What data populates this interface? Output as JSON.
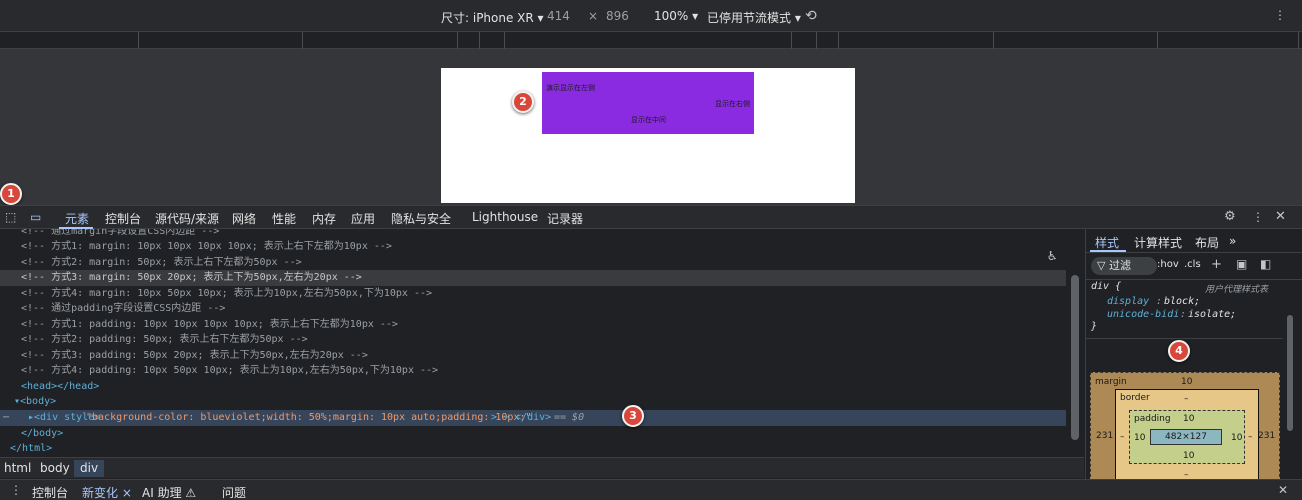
{
  "device_toolbar": {
    "dimensions_label": "尺寸: iPhone XR ▾",
    "width": "414",
    "times": "×",
    "height": "896",
    "zoom": "100% ▾",
    "throttle": "已停用节流模式 ▾"
  },
  "preview": {
    "left_text": "演示显示在左侧",
    "right_text": "显示在右侧",
    "center_text": "显示在中间",
    "box_color": "#8a2be2"
  },
  "badges": [
    "1",
    "2",
    "3",
    "4"
  ],
  "tabs": [
    "元素",
    "控制台",
    "源代码/来源",
    "网络",
    "性能",
    "内存",
    "应用",
    "隐私与安全",
    "Lighthouse",
    "记录器"
  ],
  "elements": {
    "lines": [
      "<!-- 通过margin字段设置CSS内边距 -->",
      "<!-- 方式1: margin: 10px 10px 10px 10px; 表示上右下左都为10px -->",
      "<!-- 方式2: margin: 50px; 表示上右下左都为50px -->",
      "<!-- 方式3: margin: 50px 20px; 表示上下为50px,左右为20px -->",
      "<!-- 方式4: margin: 10px 50px 10px; 表示上为10px,左右为50px,下为10px -->",
      "<!-- 通过padding字段设置CSS内边距 -->",
      "<!-- 方式1: padding: 10px 10px 10px 10px; 表示上右下左都为10px -->",
      "<!-- 方式2: padding: 50px; 表示上右下左都为50px -->",
      "<!-- 方式3: padding: 50px 20px; 表示上下为50px,左右为20px -->",
      "<!-- 方式4: padding: 10px 50px 10px; 表示上为10px,左右为50px,下为10px -->"
    ],
    "head_line": "<head></head>",
    "body_open": "▾<body>",
    "div_open": "▸<div style=",
    "div_style": "\"background-color: blueviolet;width: 50%;margin: 10px auto;padding: 10px;\"",
    "div_close": "> ⋯ </div>",
    "div_eq": "== $0",
    "body_close": "</body>",
    "html_close": "</html>"
  },
  "breadcrumbs": [
    "html",
    "body",
    "div"
  ],
  "styles": {
    "tabs": [
      "样式",
      "计算样式",
      "布局",
      "»"
    ],
    "filter": "▽ 过滤",
    "hov": ":hov",
    "cls": ".cls",
    "selector": "div {",
    "source": "用户代理样式表",
    "prop1_name": "display",
    "prop1_value": "block;",
    "prop2_name": "unicode-bidi",
    "prop2_value": "isolate;",
    "close": "}",
    "box": {
      "margin_label": "margin",
      "margin_top": "10",
      "margin_left": "231",
      "margin_right": "231",
      "border_label": "border",
      "border_val": "–",
      "padding_label": "padding",
      "padding_top": "10",
      "padding_left": "10",
      "padding_right": "10",
      "padding_bottom": "10",
      "content": "482×127",
      "dash1": "–",
      "dash2": "–",
      "dash3": "–"
    }
  },
  "bottom_tabs": [
    "控制台",
    "新变化 ×",
    "AI 助理 ⚠",
    "问题"
  ]
}
